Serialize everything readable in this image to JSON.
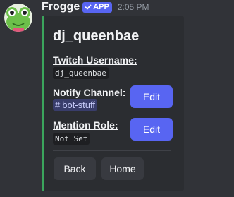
{
  "message": {
    "author": "Frogge",
    "badge": "APP",
    "timestamp": "2:05 PM"
  },
  "embed": {
    "title": "dj_queenbae",
    "accent_color": "#3ba55c",
    "fields": {
      "twitch_username": {
        "name": "Twitch Username:",
        "value": "dj_queenbae"
      },
      "notify_channel": {
        "name": "Notify Channel:",
        "channel_prefix": "#",
        "value": "bot-stuff"
      },
      "mention_role": {
        "name": "Mention Role:",
        "value": "Not Set"
      }
    }
  },
  "buttons": {
    "edit_notify": "Edit",
    "edit_mention": "Edit",
    "back": "Back",
    "home": "Home"
  },
  "icons": {
    "avatar": "frog-avatar-icon",
    "badge_check": "checkmark-icon"
  },
  "colors": {
    "primary_button": "#5865f2",
    "secondary_button": "#383a40",
    "background": "#313338",
    "embed_background": "#2b2d31"
  }
}
